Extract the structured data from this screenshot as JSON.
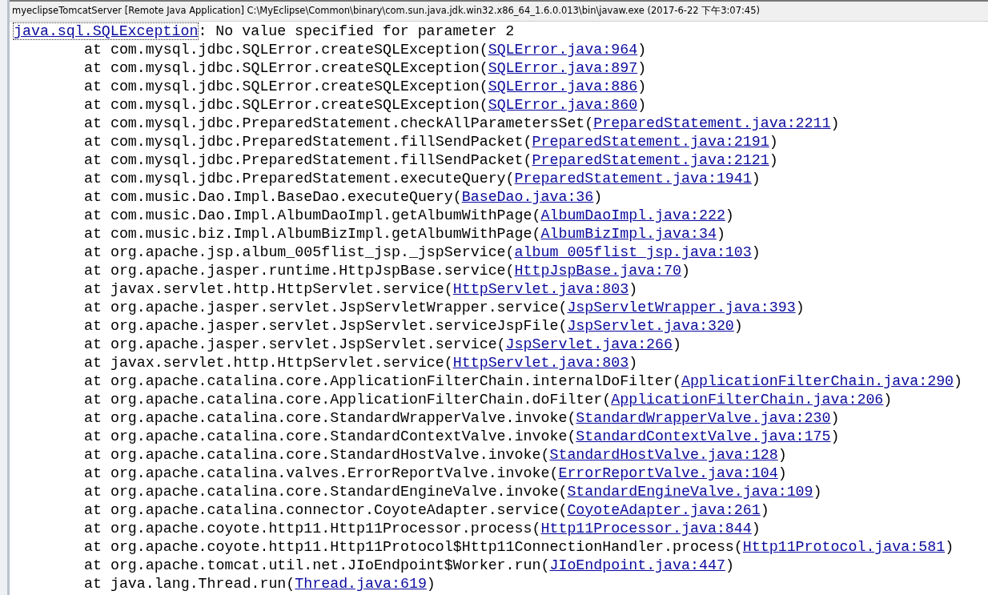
{
  "console": {
    "title": "myeclipseTomcatServer [Remote Java Application] C:\\MyEclipse\\Common\\binary\\com.sun.java.jdk.win32.x86_64_1.6.0.013\\bin\\javaw.exe (2017-6-22 下午3:07:45)",
    "exception": {
      "link": "java.sql.SQLException",
      "message": ": No value specified for parameter 2"
    },
    "frames": [
      {
        "prefix": "at com.mysql.jdbc.SQLError.createSQLException(",
        "link": "SQLError.java:964",
        "suffix": ")"
      },
      {
        "prefix": "at com.mysql.jdbc.SQLError.createSQLException(",
        "link": "SQLError.java:897",
        "suffix": ")"
      },
      {
        "prefix": "at com.mysql.jdbc.SQLError.createSQLException(",
        "link": "SQLError.java:886",
        "suffix": ")"
      },
      {
        "prefix": "at com.mysql.jdbc.SQLError.createSQLException(",
        "link": "SQLError.java:860",
        "suffix": ")"
      },
      {
        "prefix": "at com.mysql.jdbc.PreparedStatement.checkAllParametersSet(",
        "link": "PreparedStatement.java:2211",
        "suffix": ")"
      },
      {
        "prefix": "at com.mysql.jdbc.PreparedStatement.fillSendPacket(",
        "link": "PreparedStatement.java:2191",
        "suffix": ")"
      },
      {
        "prefix": "at com.mysql.jdbc.PreparedStatement.fillSendPacket(",
        "link": "PreparedStatement.java:2121",
        "suffix": ")"
      },
      {
        "prefix": "at com.mysql.jdbc.PreparedStatement.executeQuery(",
        "link": "PreparedStatement.java:1941",
        "suffix": ")"
      },
      {
        "prefix": "at com.music.Dao.Impl.BaseDao.executeQuery(",
        "link": "BaseDao.java:36",
        "suffix": ")"
      },
      {
        "prefix": "at com.music.Dao.Impl.AlbumDaoImpl.getAlbumWithPage(",
        "link": "AlbumDaoImpl.java:222",
        "suffix": ")"
      },
      {
        "prefix": "at com.music.biz.Impl.AlbumBizImpl.getAlbumWithPage(",
        "link": "AlbumBizImpl.java:34",
        "suffix": ")"
      },
      {
        "prefix": "at org.apache.jsp.album_005flist_jsp._jspService(",
        "link": "album_005flist_jsp.java:103",
        "suffix": ")"
      },
      {
        "prefix": "at org.apache.jasper.runtime.HttpJspBase.service(",
        "link": "HttpJspBase.java:70",
        "suffix": ")"
      },
      {
        "prefix": "at javax.servlet.http.HttpServlet.service(",
        "link": "HttpServlet.java:803",
        "suffix": ")"
      },
      {
        "prefix": "at org.apache.jasper.servlet.JspServletWrapper.service(",
        "link": "JspServletWrapper.java:393",
        "suffix": ")"
      },
      {
        "prefix": "at org.apache.jasper.servlet.JspServlet.serviceJspFile(",
        "link": "JspServlet.java:320",
        "suffix": ")"
      },
      {
        "prefix": "at org.apache.jasper.servlet.JspServlet.service(",
        "link": "JspServlet.java:266",
        "suffix": ")"
      },
      {
        "prefix": "at javax.servlet.http.HttpServlet.service(",
        "link": "HttpServlet.java:803",
        "suffix": ")"
      },
      {
        "prefix": "at org.apache.catalina.core.ApplicationFilterChain.internalDoFilter(",
        "link": "ApplicationFilterChain.java:290",
        "suffix": ")"
      },
      {
        "prefix": "at org.apache.catalina.core.ApplicationFilterChain.doFilter(",
        "link": "ApplicationFilterChain.java:206",
        "suffix": ")"
      },
      {
        "prefix": "at org.apache.catalina.core.StandardWrapperValve.invoke(",
        "link": "StandardWrapperValve.java:230",
        "suffix": ")"
      },
      {
        "prefix": "at org.apache.catalina.core.StandardContextValve.invoke(",
        "link": "StandardContextValve.java:175",
        "suffix": ")"
      },
      {
        "prefix": "at org.apache.catalina.core.StandardHostValve.invoke(",
        "link": "StandardHostValve.java:128",
        "suffix": ")"
      },
      {
        "prefix": "at org.apache.catalina.valves.ErrorReportValve.invoke(",
        "link": "ErrorReportValve.java:104",
        "suffix": ")"
      },
      {
        "prefix": "at org.apache.catalina.core.StandardEngineValve.invoke(",
        "link": "StandardEngineValve.java:109",
        "suffix": ")"
      },
      {
        "prefix": "at org.apache.catalina.connector.CoyoteAdapter.service(",
        "link": "CoyoteAdapter.java:261",
        "suffix": ")"
      },
      {
        "prefix": "at org.apache.coyote.http11.Http11Processor.process(",
        "link": "Http11Processor.java:844",
        "suffix": ")"
      },
      {
        "prefix": "at org.apache.coyote.http11.Http11Protocol$Http11ConnectionHandler.process(",
        "link": "Http11Protocol.java:581",
        "suffix": ")"
      },
      {
        "prefix": "at org.apache.tomcat.util.net.JIoEndpoint$Worker.run(",
        "link": "JIoEndpoint.java:447",
        "suffix": ")"
      },
      {
        "prefix": "at java.lang.Thread.run(",
        "link": "Thread.java:619",
        "suffix": ")"
      }
    ]
  }
}
